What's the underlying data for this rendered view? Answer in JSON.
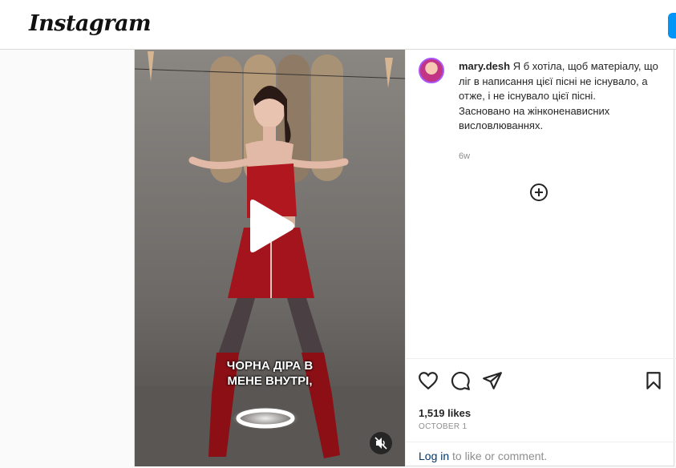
{
  "header": {
    "logo": "Instagram"
  },
  "post": {
    "overlay_caption_line1": "ЧОРНА ДІРА В",
    "overlay_caption_line2": "МЕНЕ ВНУТРІ,",
    "username": "mary.desh",
    "caption_text": "Я б хотіла, щоб матеріалу, що ліг в написання цієї пісні не існувало, а отже, і не існувало цієї пісні.",
    "caption_text_2": "Засновано на жінконенависних висловлюваннях.",
    "time_ago": "6w",
    "likes": "1,519 likes",
    "date": "OCTOBER 1",
    "login_link": "Log in",
    "login_suffix": " to like or comment."
  },
  "icons": {
    "play": "play-icon",
    "mute": "muted-speaker-icon",
    "more": "plus-circle-icon",
    "like": "heart-icon",
    "comment": "comment-bubble-icon",
    "share": "paper-plane-icon",
    "save": "bookmark-icon"
  },
  "colors": {
    "accent": "#0095f6",
    "link": "#00376b",
    "muted": "#8e8e8e"
  }
}
